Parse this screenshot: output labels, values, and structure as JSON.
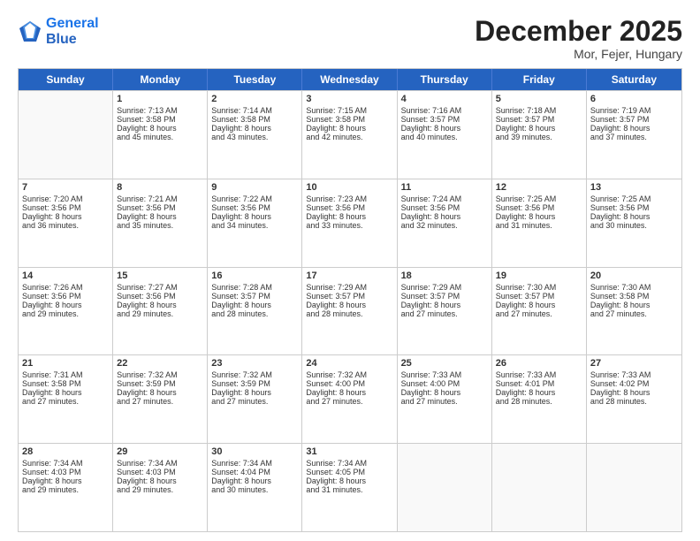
{
  "header": {
    "logo_line1": "General",
    "logo_line2": "Blue",
    "month": "December 2025",
    "location": "Mor, Fejer, Hungary"
  },
  "weekdays": [
    "Sunday",
    "Monday",
    "Tuesday",
    "Wednesday",
    "Thursday",
    "Friday",
    "Saturday"
  ],
  "weeks": [
    [
      {
        "day": "",
        "info": ""
      },
      {
        "day": "1",
        "info": "Sunrise: 7:13 AM\nSunset: 3:58 PM\nDaylight: 8 hours\nand 45 minutes."
      },
      {
        "day": "2",
        "info": "Sunrise: 7:14 AM\nSunset: 3:58 PM\nDaylight: 8 hours\nand 43 minutes."
      },
      {
        "day": "3",
        "info": "Sunrise: 7:15 AM\nSunset: 3:58 PM\nDaylight: 8 hours\nand 42 minutes."
      },
      {
        "day": "4",
        "info": "Sunrise: 7:16 AM\nSunset: 3:57 PM\nDaylight: 8 hours\nand 40 minutes."
      },
      {
        "day": "5",
        "info": "Sunrise: 7:18 AM\nSunset: 3:57 PM\nDaylight: 8 hours\nand 39 minutes."
      },
      {
        "day": "6",
        "info": "Sunrise: 7:19 AM\nSunset: 3:57 PM\nDaylight: 8 hours\nand 37 minutes."
      }
    ],
    [
      {
        "day": "7",
        "info": "Sunrise: 7:20 AM\nSunset: 3:56 PM\nDaylight: 8 hours\nand 36 minutes."
      },
      {
        "day": "8",
        "info": "Sunrise: 7:21 AM\nSunset: 3:56 PM\nDaylight: 8 hours\nand 35 minutes."
      },
      {
        "day": "9",
        "info": "Sunrise: 7:22 AM\nSunset: 3:56 PM\nDaylight: 8 hours\nand 34 minutes."
      },
      {
        "day": "10",
        "info": "Sunrise: 7:23 AM\nSunset: 3:56 PM\nDaylight: 8 hours\nand 33 minutes."
      },
      {
        "day": "11",
        "info": "Sunrise: 7:24 AM\nSunset: 3:56 PM\nDaylight: 8 hours\nand 32 minutes."
      },
      {
        "day": "12",
        "info": "Sunrise: 7:25 AM\nSunset: 3:56 PM\nDaylight: 8 hours\nand 31 minutes."
      },
      {
        "day": "13",
        "info": "Sunrise: 7:25 AM\nSunset: 3:56 PM\nDaylight: 8 hours\nand 30 minutes."
      }
    ],
    [
      {
        "day": "14",
        "info": "Sunrise: 7:26 AM\nSunset: 3:56 PM\nDaylight: 8 hours\nand 29 minutes."
      },
      {
        "day": "15",
        "info": "Sunrise: 7:27 AM\nSunset: 3:56 PM\nDaylight: 8 hours\nand 29 minutes."
      },
      {
        "day": "16",
        "info": "Sunrise: 7:28 AM\nSunset: 3:57 PM\nDaylight: 8 hours\nand 28 minutes."
      },
      {
        "day": "17",
        "info": "Sunrise: 7:29 AM\nSunset: 3:57 PM\nDaylight: 8 hours\nand 28 minutes."
      },
      {
        "day": "18",
        "info": "Sunrise: 7:29 AM\nSunset: 3:57 PM\nDaylight: 8 hours\nand 27 minutes."
      },
      {
        "day": "19",
        "info": "Sunrise: 7:30 AM\nSunset: 3:57 PM\nDaylight: 8 hours\nand 27 minutes."
      },
      {
        "day": "20",
        "info": "Sunrise: 7:30 AM\nSunset: 3:58 PM\nDaylight: 8 hours\nand 27 minutes."
      }
    ],
    [
      {
        "day": "21",
        "info": "Sunrise: 7:31 AM\nSunset: 3:58 PM\nDaylight: 8 hours\nand 27 minutes."
      },
      {
        "day": "22",
        "info": "Sunrise: 7:32 AM\nSunset: 3:59 PM\nDaylight: 8 hours\nand 27 minutes."
      },
      {
        "day": "23",
        "info": "Sunrise: 7:32 AM\nSunset: 3:59 PM\nDaylight: 8 hours\nand 27 minutes."
      },
      {
        "day": "24",
        "info": "Sunrise: 7:32 AM\nSunset: 4:00 PM\nDaylight: 8 hours\nand 27 minutes."
      },
      {
        "day": "25",
        "info": "Sunrise: 7:33 AM\nSunset: 4:00 PM\nDaylight: 8 hours\nand 27 minutes."
      },
      {
        "day": "26",
        "info": "Sunrise: 7:33 AM\nSunset: 4:01 PM\nDaylight: 8 hours\nand 28 minutes."
      },
      {
        "day": "27",
        "info": "Sunrise: 7:33 AM\nSunset: 4:02 PM\nDaylight: 8 hours\nand 28 minutes."
      }
    ],
    [
      {
        "day": "28",
        "info": "Sunrise: 7:34 AM\nSunset: 4:03 PM\nDaylight: 8 hours\nand 29 minutes."
      },
      {
        "day": "29",
        "info": "Sunrise: 7:34 AM\nSunset: 4:03 PM\nDaylight: 8 hours\nand 29 minutes."
      },
      {
        "day": "30",
        "info": "Sunrise: 7:34 AM\nSunset: 4:04 PM\nDaylight: 8 hours\nand 30 minutes."
      },
      {
        "day": "31",
        "info": "Sunrise: 7:34 AM\nSunset: 4:05 PM\nDaylight: 8 hours\nand 31 minutes."
      },
      {
        "day": "",
        "info": ""
      },
      {
        "day": "",
        "info": ""
      },
      {
        "day": "",
        "info": ""
      }
    ]
  ]
}
